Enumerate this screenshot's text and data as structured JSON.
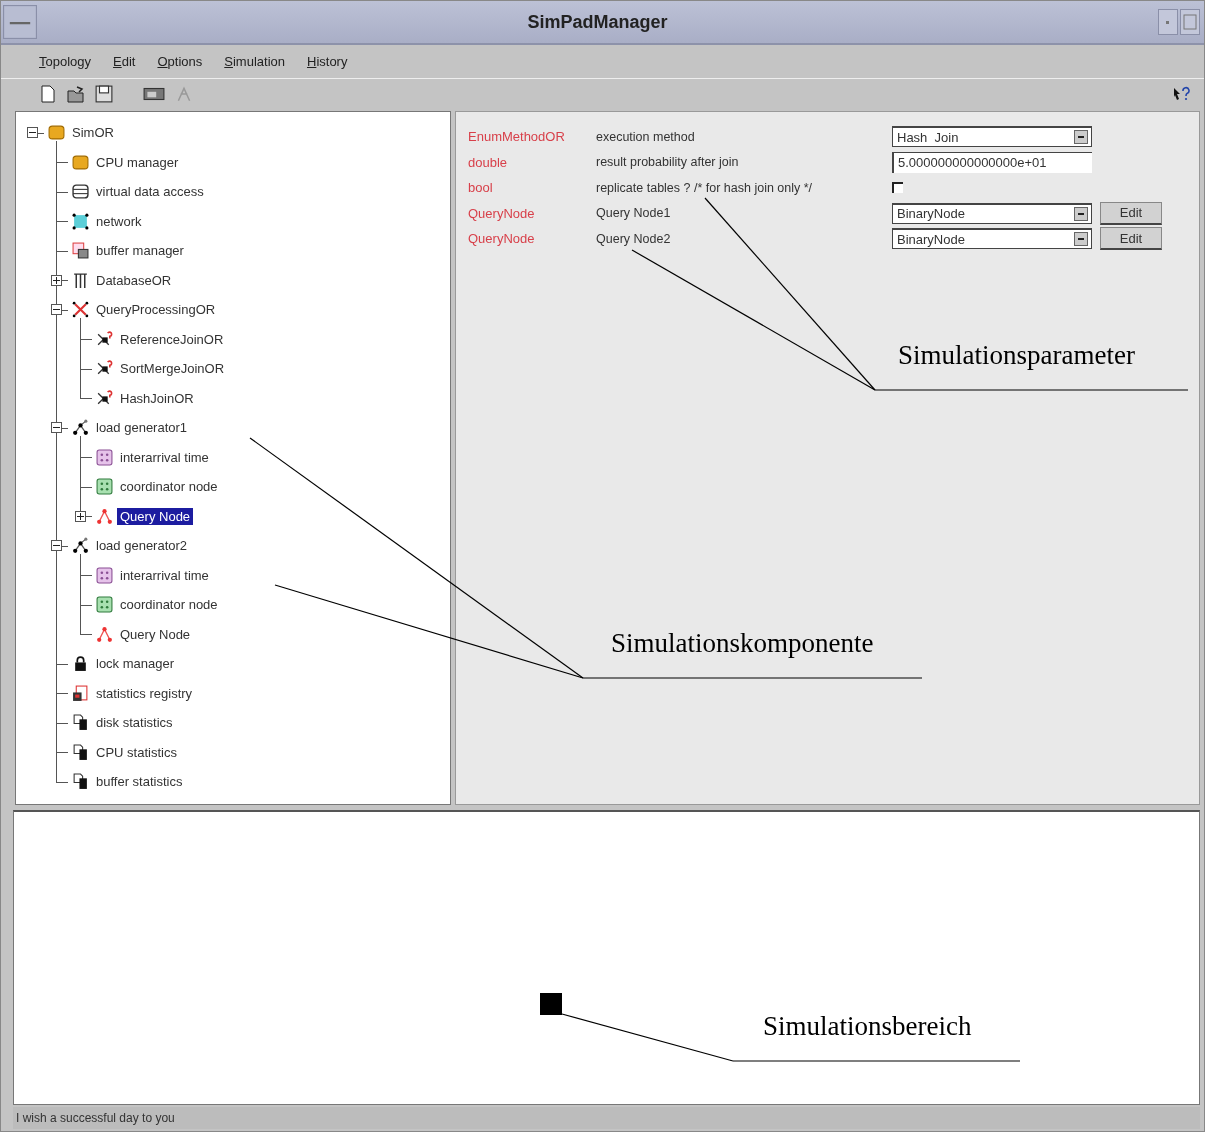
{
  "window": {
    "title": "SimPadManager"
  },
  "menu": [
    "Topology",
    "Edit",
    "Options",
    "Simulation",
    "History"
  ],
  "tree": {
    "label": "SimOR",
    "kind": "component",
    "expanded": true,
    "selected": false,
    "children": [
      {
        "label": "CPU manager",
        "kind": "component",
        "selected": false
      },
      {
        "label": "virtual data access",
        "kind": "storage",
        "selected": false
      },
      {
        "label": "network",
        "kind": "network",
        "selected": false
      },
      {
        "label": "buffer manager",
        "kind": "buffer",
        "selected": false
      },
      {
        "label": "DatabaseOR",
        "kind": "database",
        "expanded": false,
        "selected": false
      },
      {
        "label": "QueryProcessingOR",
        "kind": "query-processing",
        "expanded": true,
        "selected": false,
        "children": [
          {
            "label": "ReferenceJoinOR",
            "kind": "join",
            "selected": false
          },
          {
            "label": "SortMergeJoinOR",
            "kind": "join",
            "selected": false
          },
          {
            "label": "HashJoinOR",
            "kind": "join",
            "selected": false
          }
        ]
      },
      {
        "label": "load generator1",
        "kind": "load-generator",
        "expanded": true,
        "selected": false,
        "children": [
          {
            "label": "interarrival time",
            "kind": "interarrival",
            "selected": false
          },
          {
            "label": "coordinator node",
            "kind": "coordinator",
            "selected": false
          },
          {
            "label": "Query Node",
            "kind": "query-node",
            "expanded": false,
            "selected": true
          }
        ]
      },
      {
        "label": "load generator2",
        "kind": "load-generator",
        "expanded": true,
        "selected": false,
        "children": [
          {
            "label": "interarrival time",
            "kind": "interarrival",
            "selected": false
          },
          {
            "label": "coordinator node",
            "kind": "coordinator",
            "selected": false
          },
          {
            "label": "Query Node",
            "kind": "query-node",
            "selected": false
          }
        ]
      },
      {
        "label": "lock manager",
        "kind": "lock",
        "selected": false
      },
      {
        "label": "statistics registry",
        "kind": "registry",
        "selected": false
      },
      {
        "label": "disk statistics",
        "kind": "statistics",
        "selected": false
      },
      {
        "label": "CPU statistics",
        "kind": "statistics",
        "selected": false
      },
      {
        "label": "buffer statistics",
        "kind": "statistics",
        "selected": false
      }
    ]
  },
  "parameters": [
    {
      "type": "EnumMethodOR",
      "name": "execution method",
      "control": {
        "kind": "dropdown",
        "value": "Hash  Join"
      }
    },
    {
      "type": "double",
      "name": "result probability after join",
      "control": {
        "kind": "field",
        "value": "5.000000000000000e+01"
      }
    },
    {
      "type": "bool",
      "name": "replicate tables ? /* for hash join only */",
      "control": {
        "kind": "checkbox",
        "checked": false
      }
    },
    {
      "type": "QueryNode",
      "name": "Query Node1",
      "control": {
        "kind": "dropdown",
        "value": "BinaryNode"
      },
      "button": "Edit"
    },
    {
      "type": "QueryNode",
      "name": "Query Node2",
      "control": {
        "kind": "dropdown",
        "value": "BinaryNode"
      },
      "button": "Edit"
    }
  ],
  "status_bar": "I wish a successful day to you",
  "annotations": [
    {
      "label": "Simulationsparameter"
    },
    {
      "label": "Simulationskomponente"
    },
    {
      "label": "Simulationsbereich"
    }
  ]
}
